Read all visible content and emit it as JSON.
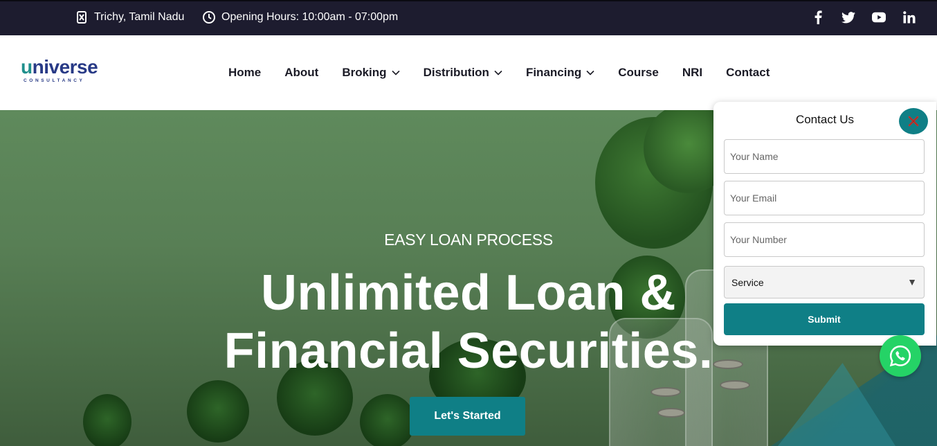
{
  "topbar": {
    "location": "Trichy, Tamil Nadu",
    "hours": "Opening Hours: 10:00am - 07:00pm",
    "social": [
      "facebook-icon",
      "twitter-icon",
      "youtube-icon",
      "linkedin-icon"
    ]
  },
  "logo": {
    "word_prefix": "u",
    "word_rest": "niverse",
    "subtitle": "CONSULTANCY"
  },
  "nav": {
    "items": [
      {
        "label": "Home",
        "dropdown": false
      },
      {
        "label": "About",
        "dropdown": false
      },
      {
        "label": "Broking",
        "dropdown": true
      },
      {
        "label": "Distribution",
        "dropdown": true
      },
      {
        "label": "Financing",
        "dropdown": true
      },
      {
        "label": "Course",
        "dropdown": false
      },
      {
        "label": "NRI",
        "dropdown": false
      },
      {
        "label": "Contact",
        "dropdown": false
      }
    ]
  },
  "hero": {
    "kicker": "EASY LOAN PROCESS",
    "headline_line1": "Unlimited Loan &",
    "headline_line2": "Financial Securities.",
    "cta": "Let's Started"
  },
  "contact_form": {
    "title": "Contact Us",
    "name_placeholder": "Your Name",
    "email_placeholder": "Your Email",
    "number_placeholder": "Your Number",
    "service_selected": "Service",
    "submit": "Submit"
  },
  "colors": {
    "topbar_bg": "#1d1c2f",
    "accent_teal": "#0f7f86",
    "brand_blue": "#283a86",
    "whatsapp_green": "#25d366"
  }
}
